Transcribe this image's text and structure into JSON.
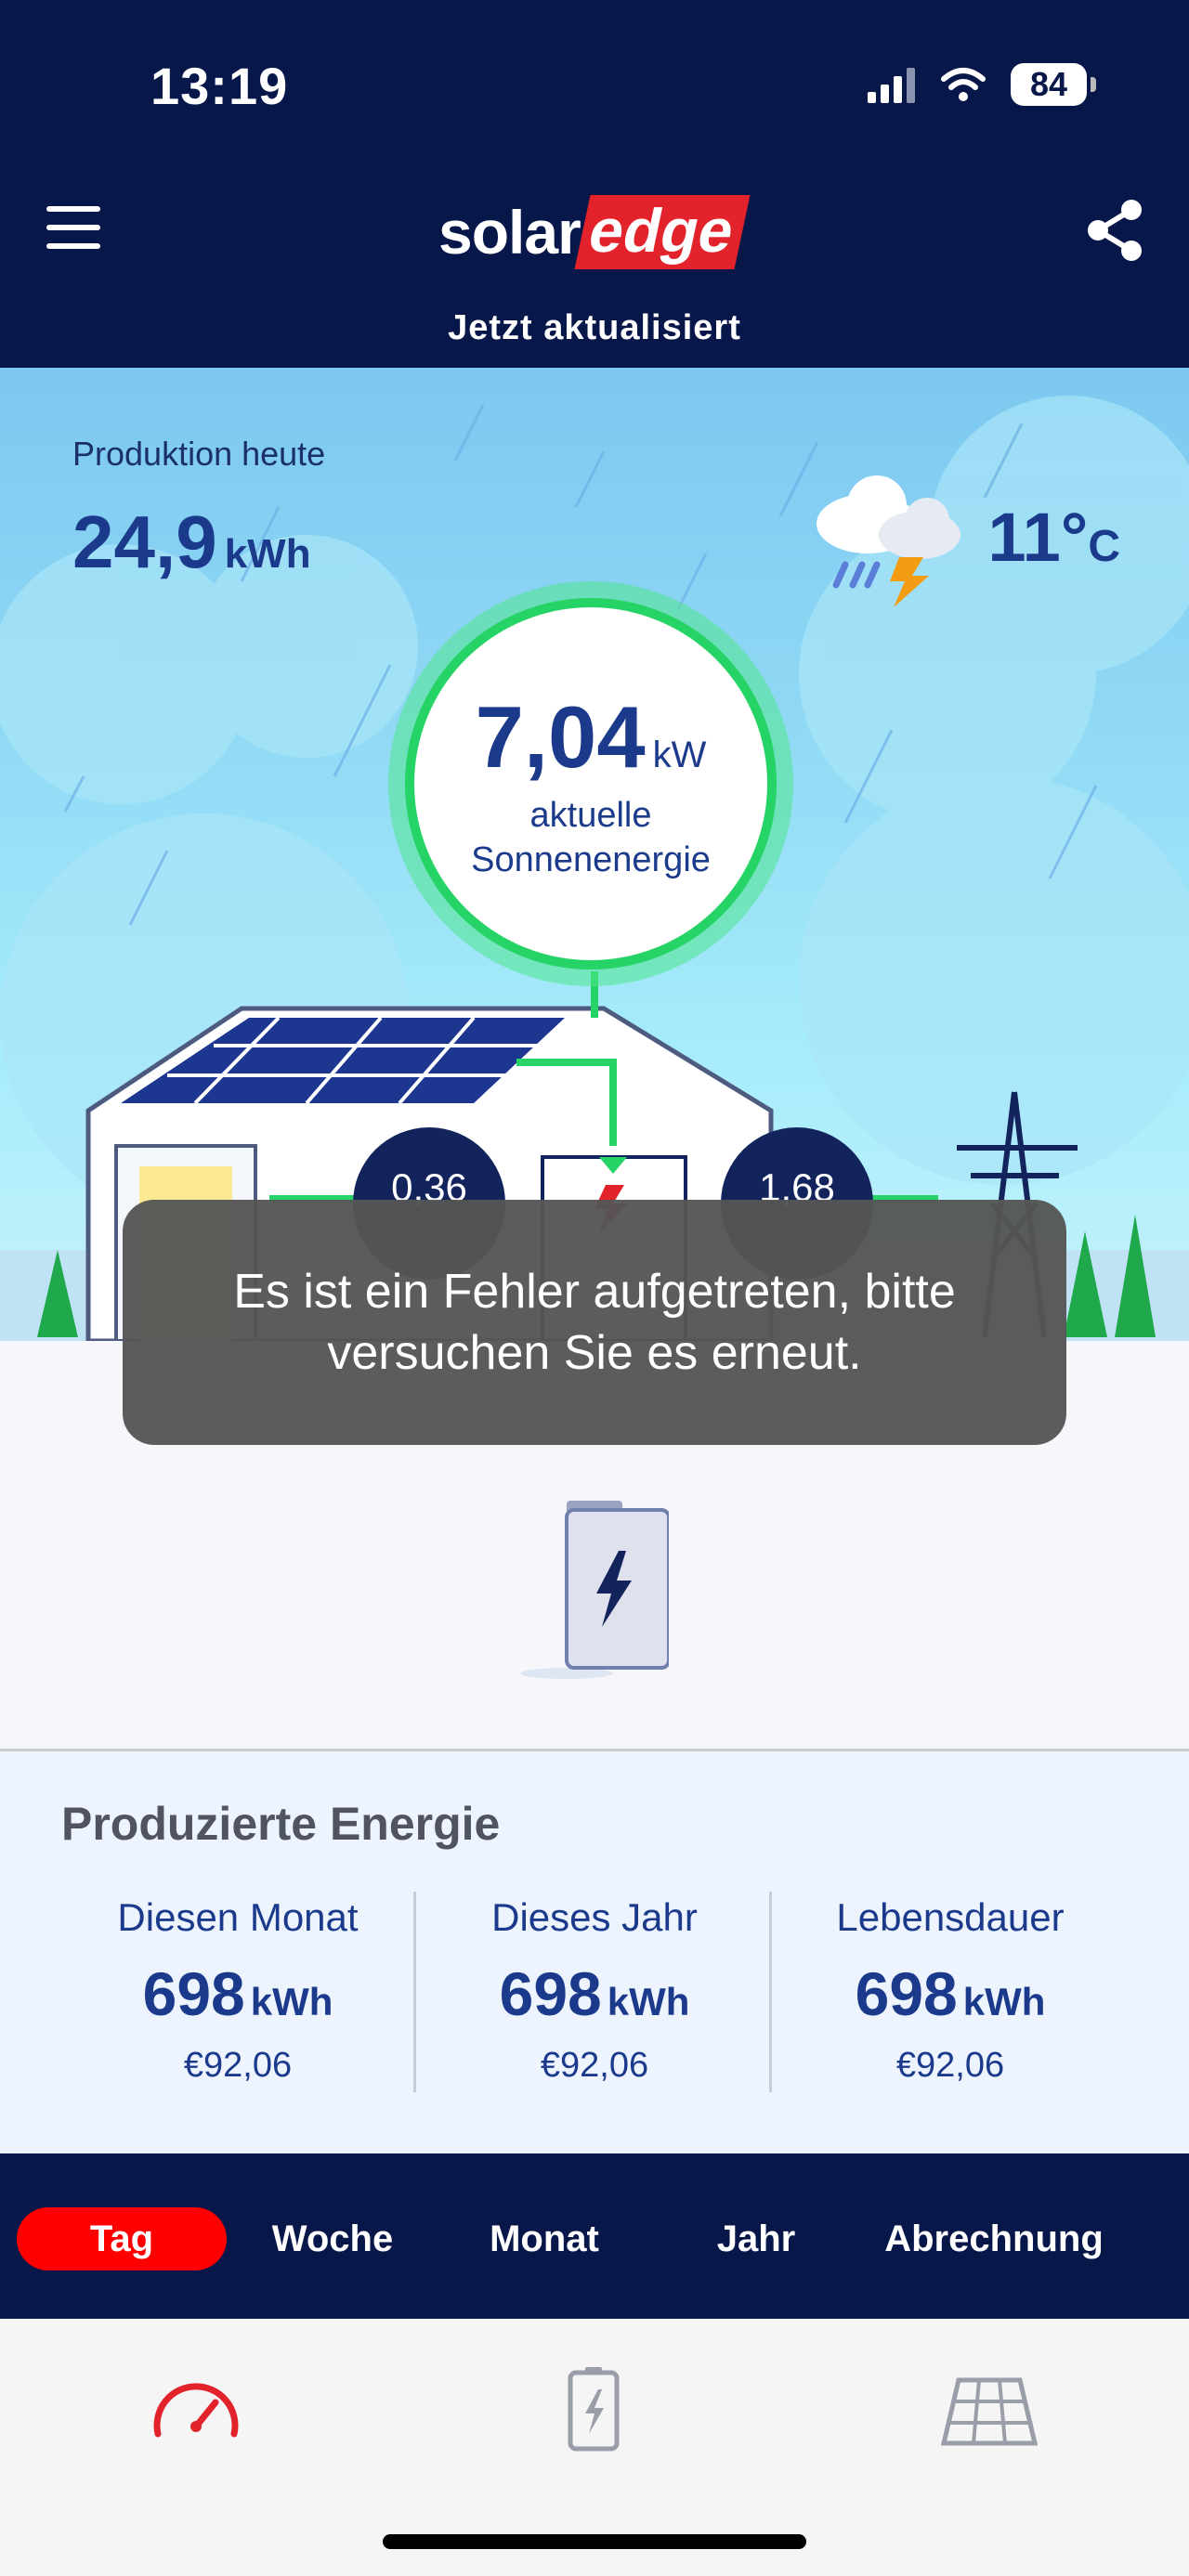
{
  "status_bar": {
    "time": "13:19",
    "battery": "84"
  },
  "header": {
    "logo_solar": "solar",
    "logo_edge": "edge",
    "update_status": "Jetzt aktualisiert"
  },
  "production": {
    "label": "Produktion heute",
    "value": "24,9",
    "unit": "kWh"
  },
  "weather": {
    "icon": "thunderstorm-icon",
    "temperature": "11°",
    "unit": "C"
  },
  "current": {
    "value": "7,04",
    "unit": "kW",
    "caption_line1": "aktuelle",
    "caption_line2": "Sonnenenergie"
  },
  "flows": {
    "consumption": "0,36",
    "grid_export": "1,68"
  },
  "toast": {
    "message": "Es ist ein Fehler aufgetreten, bitte versuchen Sie es erneut."
  },
  "produced_energy": {
    "title": "Produzierte Energie",
    "columns": [
      {
        "label": "Diesen Monat",
        "value": "698",
        "unit": "kWh",
        "money": "€92,06"
      },
      {
        "label": "Dieses Jahr",
        "value": "698",
        "unit": "kWh",
        "money": "€92,06"
      },
      {
        "label": "Lebensdauer",
        "value": "698",
        "unit": "kWh",
        "money": "€92,06"
      }
    ]
  },
  "period_tabs": {
    "selected": "Tag",
    "items": [
      "Tag",
      "Woche",
      "Monat",
      "Jahr",
      "Abrechnung"
    ]
  },
  "bottom_nav": {
    "items": [
      "dashboard-gauge-icon",
      "battery-icon",
      "solar-panel-icon"
    ],
    "active": "dashboard-gauge-icon"
  },
  "colors": {
    "navy": "#08174a",
    "accent_red": "#ff0000",
    "solar_green": "#25d366",
    "text_blue": "#1b3a8c"
  }
}
